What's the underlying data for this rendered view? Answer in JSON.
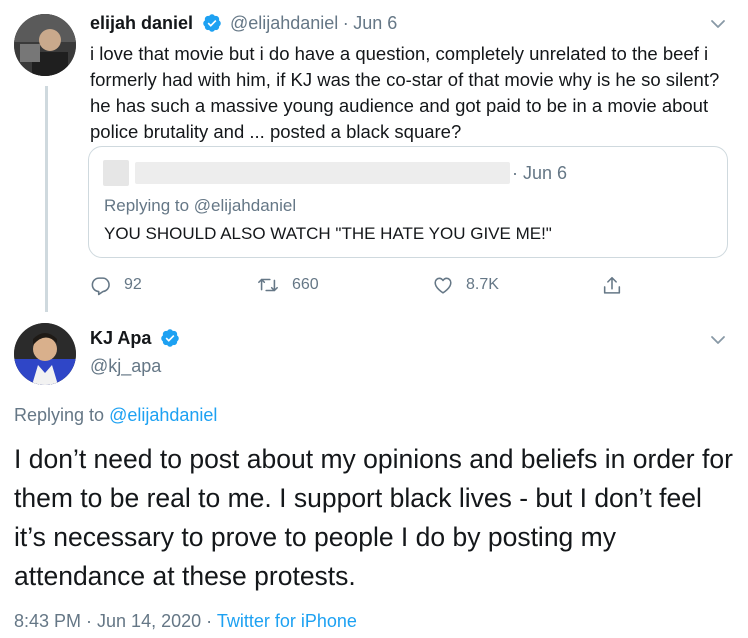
{
  "tweet1": {
    "name": "elijah daniel",
    "handle": "@elijahdaniel",
    "separator": "·",
    "date": "Jun 6",
    "text": "i love that movie but i do have a question, completely unrelated to the beef i formerly had with him, if KJ was the co-star of that movie why is he so silent? he has such a massive young audience and got paid to be in a movie about police brutality and ... posted a black square?",
    "quoted": {
      "date": "· Jun 6",
      "replying_prefix": "Replying to",
      "replying_handle": "@elijahdaniel",
      "text": "YOU SHOULD ALSO WATCH \"THE HATE YOU GIVE ME!\""
    },
    "actions": {
      "replies": "92",
      "retweets": "660",
      "likes": "8.7K"
    }
  },
  "tweet2": {
    "name": "KJ Apa",
    "handle": "@kj_apa",
    "replying_prefix": "Replying to",
    "replying_handle": "@elijahdaniel",
    "text": "I don’t need to post about my opinions and beliefs in order for them to be real to me. I support black lives - but I don’t feel it’s necessary to prove to people I do by posting my attendance at these protests.",
    "timestamp": "8:43 PM · Jun 14, 2020",
    "separator": "·",
    "source": "Twitter for iPhone"
  },
  "colors": {
    "link": "#1da1f2",
    "secondary": "#657786",
    "border": "#cfd9de"
  },
  "icons": [
    "verified-badge-icon",
    "chevron-down-icon",
    "reply-icon",
    "retweet-icon",
    "like-icon",
    "share-icon"
  ]
}
